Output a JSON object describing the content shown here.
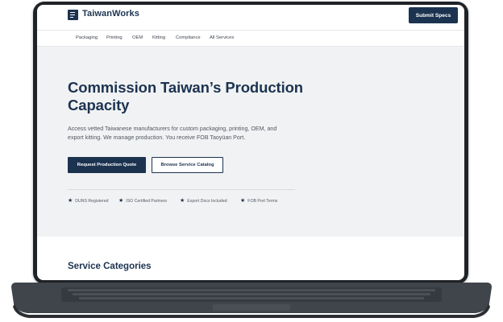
{
  "brand": {
    "name": "TaiwanWorks"
  },
  "header": {
    "cta_label": "Submit Specs"
  },
  "nav": {
    "items": [
      "Packaging",
      "Printing",
      "OEM",
      "Kitting",
      "Compliance",
      "All Services"
    ]
  },
  "hero": {
    "title_line1": "Commission Taiwan’s Production",
    "title_line2": "Capacity",
    "subtitle_line1": "Access vetted Taiwanese manufacturers for custom packaging, printing, OEM, and",
    "subtitle_line2": "export kitting. We manage production. You receive FOB Taoyüan Port.",
    "primary_cta": "Request Production Quote",
    "secondary_cta": "Browse Service Catalog"
  },
  "trust_badges": [
    {
      "icon": "star-icon",
      "label": "DUNS Registered"
    },
    {
      "icon": "star-icon",
      "label": "ISO Certified Partners"
    },
    {
      "icon": "star-icon",
      "label": "Export Docs Included"
    },
    {
      "icon": "star-icon",
      "label": "FOB Port Terms"
    }
  ],
  "services": {
    "title": "Service Categories"
  },
  "colors": {
    "brand_navy": "#1c3350",
    "hero_bg": "#f1f2f3",
    "laptop_frame": "#1f2226"
  }
}
